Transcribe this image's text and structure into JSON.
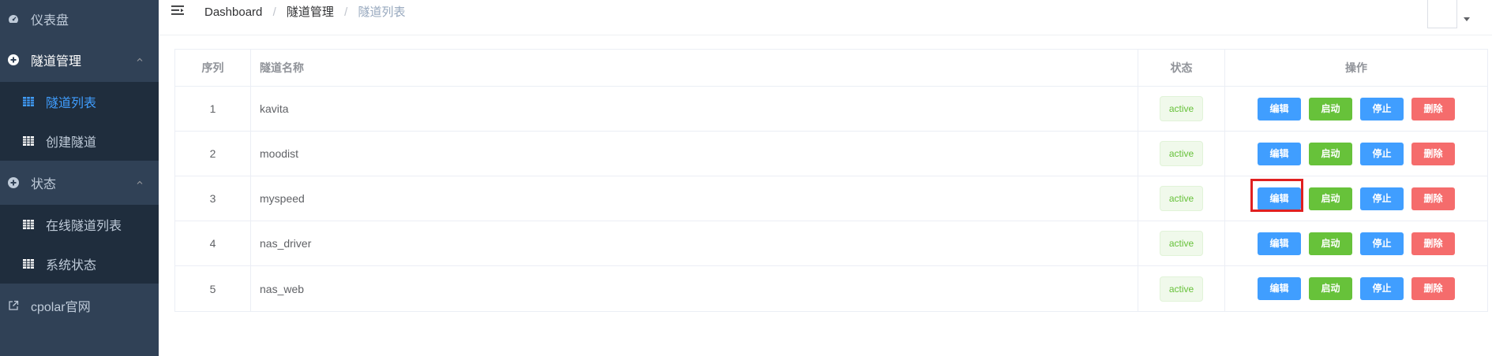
{
  "sidebar": {
    "items": [
      {
        "label": "仪表盘",
        "icon": "dashboard-icon"
      },
      {
        "label": "隧道管理",
        "icon": "plus-circle-icon"
      },
      {
        "label": "隧道列表",
        "icon": "grid-icon"
      },
      {
        "label": "创建隧道",
        "icon": "grid-icon"
      },
      {
        "label": "状态",
        "icon": "plus-circle-icon"
      },
      {
        "label": "在线隧道列表",
        "icon": "grid-icon"
      },
      {
        "label": "系统状态",
        "icon": "grid-icon"
      },
      {
        "label": "cpolar官网",
        "icon": "external-link-icon"
      }
    ],
    "active_color": "#409eff"
  },
  "breadcrumb": {
    "items": [
      "Dashboard",
      "隧道管理",
      "隧道列表"
    ],
    "separator": "/"
  },
  "table": {
    "columns": [
      "序列",
      "隧道名称",
      "状态",
      "操作"
    ],
    "rows": [
      {
        "index": "1",
        "name": "kavita",
        "status": "active"
      },
      {
        "index": "2",
        "name": "moodist",
        "status": "active"
      },
      {
        "index": "3",
        "name": "myspeed",
        "status": "active"
      },
      {
        "index": "4",
        "name": "nas_driver",
        "status": "active"
      },
      {
        "index": "5",
        "name": "nas_web",
        "status": "active"
      }
    ],
    "actions": {
      "edit": "编辑",
      "start": "启动",
      "stop": "停止",
      "delete": "删除"
    }
  },
  "colors": {
    "sidebar_bg": "#304156",
    "primary": "#409eff",
    "success": "#67c23a",
    "danger": "#f56c6c",
    "highlight": "#e02020"
  }
}
